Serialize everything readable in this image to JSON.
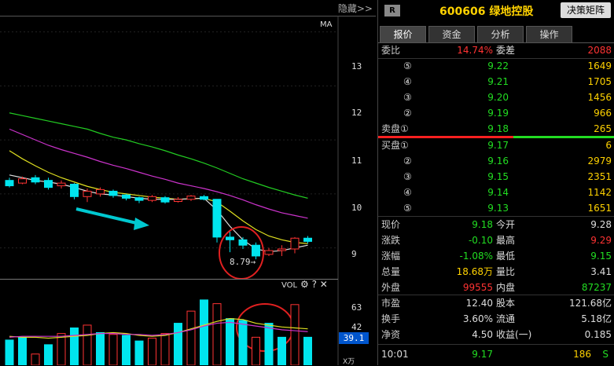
{
  "chart": {
    "hide_label": "隐藏>>",
    "ma_label": "MA",
    "y_ticks": [
      "13",
      "12",
      "11",
      "10",
      "9"
    ],
    "annotation_low": "8.79→",
    "vol_label": "VOL",
    "vol_ticks": [
      "63",
      "42"
    ],
    "current_vol": "39.1",
    "vol_unit": "X万"
  },
  "chart_data": {
    "type": "candlestick",
    "ylim": [
      8.5,
      13.3
    ],
    "candles": [
      {
        "o": 10.25,
        "c": 10.15,
        "h": 10.3,
        "l": 10.12
      },
      {
        "o": 10.2,
        "c": 10.28,
        "h": 10.32,
        "l": 10.18
      },
      {
        "o": 10.3,
        "c": 10.22,
        "h": 10.35,
        "l": 10.18
      },
      {
        "o": 10.25,
        "c": 10.12,
        "h": 10.3,
        "l": 10.08
      },
      {
        "o": 10.15,
        "c": 10.2,
        "h": 10.25,
        "l": 10.1
      },
      {
        "o": 10.18,
        "c": 9.95,
        "h": 10.2,
        "l": 9.9
      },
      {
        "o": 9.95,
        "c": 10.05,
        "h": 10.1,
        "l": 9.85
      },
      {
        "o": 10.0,
        "c": 10.08,
        "h": 10.12,
        "l": 9.95
      },
      {
        "o": 10.05,
        "c": 9.97,
        "h": 10.08,
        "l": 9.93
      },
      {
        "o": 9.98,
        "c": 9.92,
        "h": 10.0,
        "l": 9.88
      },
      {
        "o": 9.93,
        "c": 9.88,
        "h": 9.95,
        "l": 9.83
      },
      {
        "o": 9.88,
        "c": 9.95,
        "h": 9.98,
        "l": 9.85
      },
      {
        "o": 9.93,
        "c": 9.85,
        "h": 9.96,
        "l": 9.82
      },
      {
        "o": 9.86,
        "c": 9.9,
        "h": 9.94,
        "l": 9.84
      },
      {
        "o": 9.9,
        "c": 9.96,
        "h": 9.98,
        "l": 9.87
      },
      {
        "o": 9.95,
        "c": 9.9,
        "h": 9.98,
        "l": 9.88
      },
      {
        "o": 9.9,
        "c": 9.2,
        "h": 9.9,
        "l": 9.1
      },
      {
        "o": 9.2,
        "c": 9.15,
        "h": 9.3,
        "l": 8.92
      },
      {
        "o": 9.15,
        "c": 9.05,
        "h": 9.2,
        "l": 8.98
      },
      {
        "o": 9.05,
        "c": 8.85,
        "h": 9.1,
        "l": 8.79
      },
      {
        "o": 8.88,
        "c": 8.95,
        "h": 9.0,
        "l": 8.85
      },
      {
        "o": 8.95,
        "c": 8.98,
        "h": 9.05,
        "l": 8.85
      },
      {
        "o": 8.98,
        "c": 9.18,
        "h": 9.2,
        "l": 8.9
      },
      {
        "o": 9.18,
        "c": 9.12,
        "h": 9.22,
        "l": 9.08
      }
    ],
    "ma_green": [
      11.5,
      11.45,
      11.4,
      11.35,
      11.3,
      11.25,
      11.2,
      11.12,
      11.05,
      11.0,
      10.93,
      10.87,
      10.8,
      10.72,
      10.65,
      10.57,
      10.48,
      10.38,
      10.28,
      10.2,
      10.12,
      10.05,
      9.98,
      9.92
    ],
    "ma_magenta": [
      11.2,
      11.1,
      11.0,
      10.9,
      10.82,
      10.75,
      10.68,
      10.6,
      10.53,
      10.47,
      10.4,
      10.33,
      10.27,
      10.2,
      10.15,
      10.1,
      10.04,
      9.97,
      9.89,
      9.8,
      9.72,
      9.65,
      9.6,
      9.55
    ],
    "ma_yellow": [
      10.8,
      10.65,
      10.52,
      10.4,
      10.3,
      10.22,
      10.14,
      10.08,
      10.03,
      10.0,
      9.97,
      9.94,
      9.92,
      9.9,
      9.91,
      9.92,
      9.85,
      9.68,
      9.5,
      9.34,
      9.22,
      9.15,
      9.1,
      9.08
    ],
    "ma_white": [
      10.35,
      10.3,
      10.25,
      10.22,
      10.18,
      10.12,
      10.05,
      10.0,
      9.98,
      9.95,
      9.92,
      9.9,
      9.9,
      9.9,
      9.91,
      9.92,
      9.7,
      9.4,
      9.15,
      8.98,
      8.93,
      8.95,
      9.0,
      9.05
    ],
    "vol_ylim": [
      0,
      80
    ],
    "volumes": [
      {
        "v": 27,
        "up": false
      },
      {
        "v": 30,
        "up": false
      },
      {
        "v": 12,
        "up": true
      },
      {
        "v": 22,
        "up": false
      },
      {
        "v": 34,
        "up": true
      },
      {
        "v": 40,
        "up": false
      },
      {
        "v": 43,
        "up": true
      },
      {
        "v": 35,
        "up": false
      },
      {
        "v": 33,
        "up": true
      },
      {
        "v": 32,
        "up": false
      },
      {
        "v": 26,
        "up": false
      },
      {
        "v": 29,
        "up": true
      },
      {
        "v": 34,
        "up": true
      },
      {
        "v": 45,
        "up": false
      },
      {
        "v": 58,
        "up": true
      },
      {
        "v": 70,
        "up": false
      },
      {
        "v": 66,
        "up": true
      },
      {
        "v": 50,
        "up": false
      },
      {
        "v": 48,
        "up": false
      },
      {
        "v": 30,
        "up": true
      },
      {
        "v": 45,
        "up": false
      },
      {
        "v": 30,
        "up": false
      },
      {
        "v": 65,
        "up": true
      },
      {
        "v": 30,
        "up": false
      }
    ],
    "vol_ma_yellow": [
      31,
      30,
      30,
      29,
      30,
      31,
      32,
      34,
      35,
      34,
      32,
      31,
      32,
      35,
      39,
      43,
      47,
      50,
      49,
      45,
      43,
      41,
      40,
      39
    ],
    "vol_ma_magenta": [
      30,
      31,
      31,
      31,
      31,
      32,
      33,
      34,
      34,
      33,
      33,
      32,
      33,
      35,
      38,
      42,
      45,
      46,
      44,
      42,
      40,
      38,
      37,
      36
    ]
  },
  "panel": {
    "r_badge": "R",
    "stock": "600606 绿地控股",
    "decision_btn": "决策矩阵",
    "tabs": [
      "报价",
      "资金",
      "分析",
      "操作"
    ],
    "weibi_label": "委比",
    "weibi_val": "14.74%",
    "weicha_label": "委差",
    "weicha_val": "2088",
    "sells": [
      {
        "n": "⑤",
        "price": "9.22",
        "vol": "1649"
      },
      {
        "n": "④",
        "price": "9.21",
        "vol": "1705"
      },
      {
        "n": "③",
        "price": "9.20",
        "vol": "1456"
      },
      {
        "n": "②",
        "price": "9.19",
        "vol": "966"
      },
      {
        "n": "卖盘①",
        "price": "9.18",
        "vol": "265"
      }
    ],
    "buys": [
      {
        "n": "买盘①",
        "price": "9.17",
        "vol": "6"
      },
      {
        "n": "②",
        "price": "9.16",
        "vol": "2979"
      },
      {
        "n": "③",
        "price": "9.15",
        "vol": "2351"
      },
      {
        "n": "④",
        "price": "9.14",
        "vol": "1142"
      },
      {
        "n": "⑤",
        "price": "9.13",
        "vol": "1651"
      }
    ],
    "stats1": [
      {
        "l1": "现价",
        "v1": "9.18",
        "l2": "今开",
        "v2": "9.28"
      },
      {
        "l1": "涨跌",
        "v1": "-0.10",
        "l2": "最高",
        "v2": "9.29"
      },
      {
        "l1": "涨幅",
        "v1": "-1.08%",
        "l2": "最低",
        "v2": "9.15"
      },
      {
        "l1": "总量",
        "v1": "18.68万",
        "l2": "量比",
        "v2": "3.41"
      },
      {
        "l1": "外盘",
        "v1": "99555",
        "l2": "内盘",
        "v2": "87237"
      }
    ],
    "stats2": [
      {
        "l1": "市盈",
        "v1": "12.40",
        "l2": "股本",
        "v2": "121.68亿"
      },
      {
        "l1": "换手",
        "v1": "3.60%",
        "l2": "流通",
        "v2": "5.18亿"
      },
      {
        "l1": "净资",
        "v1": "4.50",
        "l2": "收益(一)",
        "v2": "0.185"
      }
    ],
    "tick": {
      "time": "10:01",
      "price": "9.17",
      "vol": "186",
      "side": "S"
    }
  },
  "colors": {
    "up": "#ff3333",
    "down": "#00e5ee",
    "accent": "#ffd200"
  }
}
